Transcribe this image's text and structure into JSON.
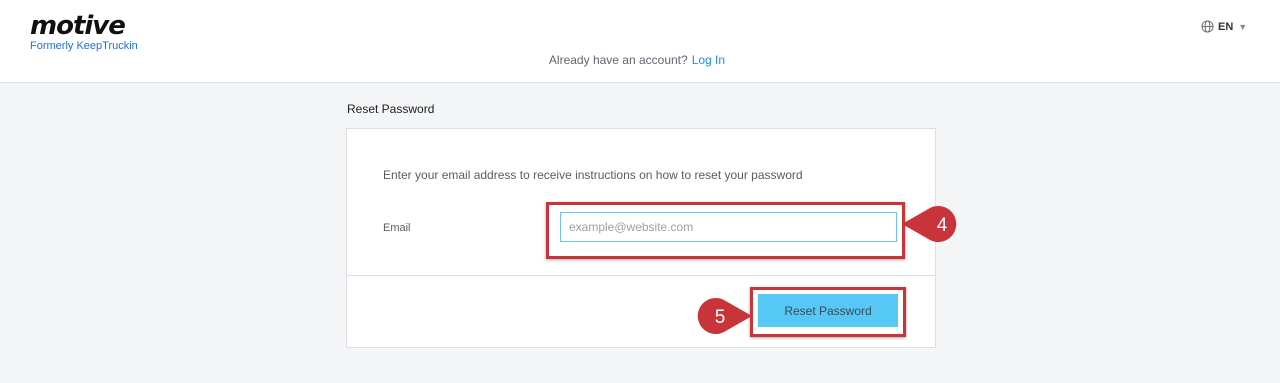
{
  "header": {
    "logo_text": "motive",
    "logo_subtitle": "Formerly KeepTruckin",
    "account_prompt": "Already have an account?",
    "login_link": "Log In",
    "language": "EN",
    "language_icon": "globe-icon"
  },
  "main": {
    "section_title": "Reset Password",
    "instructions": "Enter your email address to receive instructions on how to reset your password",
    "email_label": "Email",
    "email_placeholder": "example@website.com",
    "email_value": "",
    "submit_label": "Reset Password"
  },
  "annotations": {
    "step_email": "4",
    "step_submit": "5",
    "highlight_color": "#c9343a"
  },
  "colors": {
    "accent": "#55c8f5",
    "link": "#1a8fe0",
    "brand_sub": "#1e6fd9"
  }
}
